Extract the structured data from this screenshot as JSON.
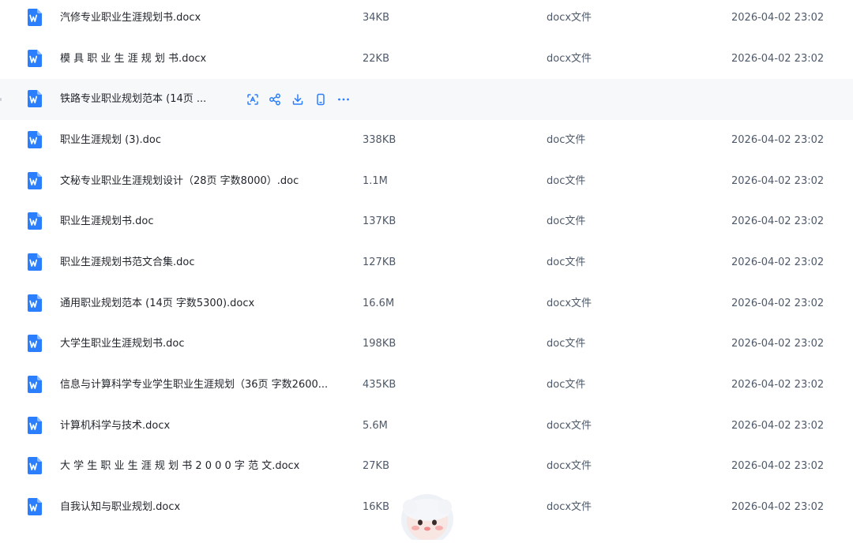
{
  "colors": {
    "accent": "#2b7fff",
    "row_hover": "#f7f8fa",
    "text_primary": "#1f2329",
    "text_secondary": "#4e5969"
  },
  "row_actions": [
    "scan-icon",
    "share-icon",
    "download-icon",
    "phone-icon",
    "more-icon"
  ],
  "files": [
    {
      "name": "汽修专业职业生涯规划书.docx",
      "size": "34KB",
      "type": "docx文件",
      "date": "2026-04-02 23:02"
    },
    {
      "name": "模 具 职 业 生 涯 规 划 书.docx",
      "size": "22KB",
      "type": "docx文件",
      "date": "2026-04-02 23:02"
    },
    {
      "name": "铁路专业职业规划范本 (14页 ...",
      "size": "",
      "type": "",
      "date": "",
      "hovered": true
    },
    {
      "name": "职业生涯规划 (3).doc",
      "size": "338KB",
      "type": "doc文件",
      "date": "2026-04-02 23:02"
    },
    {
      "name": "文秘专业职业生涯规划设计（28页 字数8000）.doc",
      "size": "1.1M",
      "type": "doc文件",
      "date": "2026-04-02 23:02"
    },
    {
      "name": "职业生涯规划书.doc",
      "size": "137KB",
      "type": "doc文件",
      "date": "2026-04-02 23:02"
    },
    {
      "name": "职业生涯规划书范文合集.doc",
      "size": "127KB",
      "type": "doc文件",
      "date": "2026-04-02 23:02"
    },
    {
      "name": "通用职业规划范本 (14页 字数5300).docx",
      "size": "16.6M",
      "type": "docx文件",
      "date": "2026-04-02 23:02"
    },
    {
      "name": "大学生职业生涯规划书.doc",
      "size": "198KB",
      "type": "doc文件",
      "date": "2026-04-02 23:02"
    },
    {
      "name": "信息与计算科学专业学生职业生涯规划（36页 字数2600...",
      "size": "435KB",
      "type": "doc文件",
      "date": "2026-04-02 23:02"
    },
    {
      "name": "计算机科学与技术.docx",
      "size": "5.6M",
      "type": "docx文件",
      "date": "2026-04-02 23:02"
    },
    {
      "name": "大 学 生 职 业 生 涯 规 划 书 2 0 0 0 字 范 文.docx",
      "size": "27KB",
      "type": "docx文件",
      "date": "2026-04-02 23:02"
    },
    {
      "name": "自我认知与职业规划.docx",
      "size": "16KB",
      "type": "docx文件",
      "date": "2026-04-02 23:02"
    }
  ]
}
